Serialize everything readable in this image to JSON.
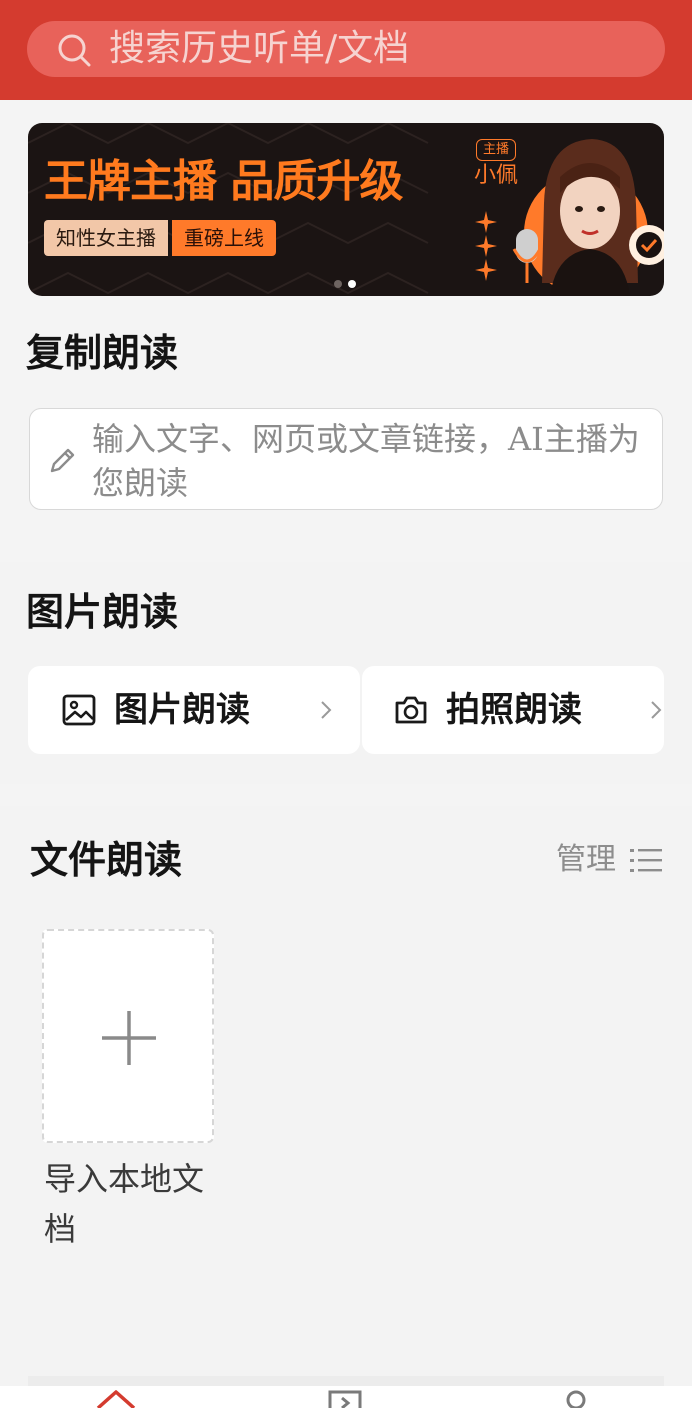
{
  "search": {
    "placeholder": "搜索历史听单/文档",
    "icon": "search-icon"
  },
  "banner": {
    "title": "王牌主播 品质升级",
    "tags": [
      "知性女主播",
      "重磅上线"
    ],
    "badge": "主播",
    "host_name": "小佩",
    "carousel": {
      "count": 2,
      "active_index": 1
    }
  },
  "copy_read": {
    "title": "复制朗读",
    "input_placeholder": "输入文字、网页或文章链接，AI主播为您朗读",
    "icon": "pencil-icon"
  },
  "image_read": {
    "title": "图片朗读",
    "cards": [
      {
        "label": "图片朗读",
        "icon": "image-icon"
      },
      {
        "label": "拍照朗读",
        "icon": "camera-icon"
      }
    ]
  },
  "file_read": {
    "title": "文件朗读",
    "manage_label": "管理",
    "import_label": "导入本地文档"
  },
  "tabbar": {
    "icons": [
      "home-icon",
      "play-icon",
      "profile-icon"
    ],
    "active_color": "#d43b2f"
  },
  "colors": {
    "brand": "#d43b2f",
    "accent": "#ff7a1e"
  }
}
